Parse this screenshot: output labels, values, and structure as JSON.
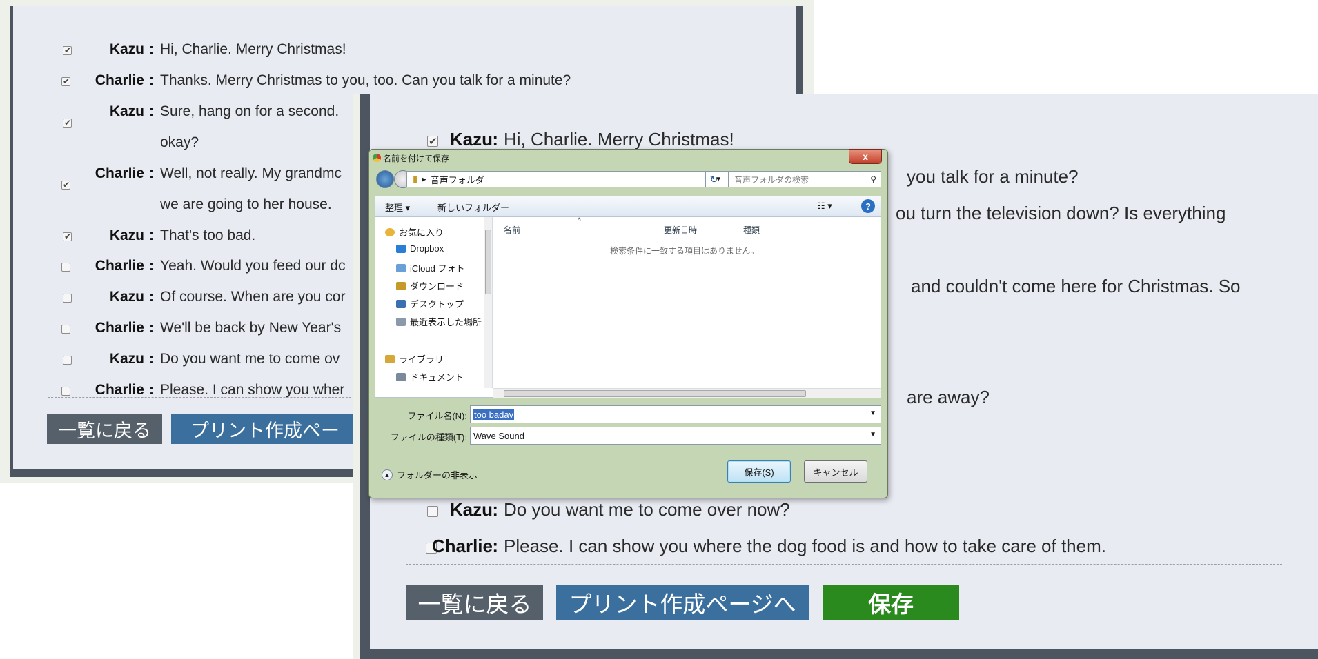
{
  "dialogue": [
    {
      "speaker": "Kazu",
      "text": "Hi, Charlie. Merry Christmas!",
      "checked": true
    },
    {
      "speaker": "Charlie",
      "text": "Thanks. Merry Christmas to you, too. Can you talk for a minute?",
      "checked": true
    },
    {
      "speaker": "Kazu",
      "text": "Sure, hang on for a second.",
      "text_line2": "okay?",
      "checked": true
    },
    {
      "speaker": "Charlie",
      "text": "Well, not really. My grandmc",
      "text_line2": "we are going to her house.",
      "checked": true
    },
    {
      "speaker": "Kazu",
      "text": "That's too bad.",
      "checked": true
    },
    {
      "speaker": "Charlie",
      "text": "Yeah. Would you feed our dc",
      "checked": false
    },
    {
      "speaker": "Kazu",
      "text": "Of course. When are you cor",
      "checked": false
    },
    {
      "speaker": "Charlie",
      "text": "We'll be back by New Year's",
      "checked": false
    },
    {
      "speaker": "Kazu",
      "text": "Do you want me to come ov",
      "checked": false
    },
    {
      "speaker": "Charlie",
      "text": "Please. I can show you wher",
      "checked": false
    }
  ],
  "speaker_sep": " :",
  "back_buttons": {
    "back": "一覧に戻る",
    "print": "プリント作成ペー"
  },
  "front": {
    "rows": [
      {
        "speaker": "Kazu",
        "text": "Hi, Charlie. Merry Christmas!",
        "checked": true
      },
      {
        "text": "you talk for a minute?"
      },
      {
        "text": "ou turn the television down? Is everything"
      },
      {
        "text": "and couldn't come here for Christmas. So"
      },
      {
        "text": "are away?"
      },
      {
        "speaker": "Kazu",
        "text": "Do you want me to come over now?",
        "checked": false
      },
      {
        "speaker": "Charlie",
        "text": "Please. I can show you where the dog food is and how to take care of them.",
        "checked": false
      }
    ],
    "buttons": {
      "back": "一覧に戻る",
      "print": "プリント作成ページへ",
      "save": "保存"
    },
    "colors": {
      "back_button": "#56606b",
      "print_button": "#3b6f9e",
      "save_button": "#2b8a1e",
      "frame": "#4d5560"
    }
  },
  "dialog": {
    "title": "名前を付けて保存",
    "close_label": "x",
    "address": "音声フォルダ",
    "search_placeholder": "音声フォルダの検索",
    "toolbar": {
      "organize": "整理 ▾",
      "new_folder": "新しいフォルダー",
      "view": "☷ ▾",
      "help": "?"
    },
    "nav_items": [
      {
        "label": "お気に入り",
        "icon": "star-icon"
      },
      {
        "label": "Dropbox",
        "icon": "dropbox-icon"
      },
      {
        "label": "iCloud フォト",
        "icon": "icloud-icon"
      },
      {
        "label": "ダウンロード",
        "icon": "download-folder-icon"
      },
      {
        "label": "デスクトップ",
        "icon": "desktop-icon"
      },
      {
        "label": "最近表示した場所",
        "icon": "recent-places-icon"
      },
      {
        "label": "ライブラリ",
        "icon": "library-icon"
      },
      {
        "label": "ドキュメント",
        "icon": "documents-icon"
      }
    ],
    "columns": {
      "name": "名前",
      "modified": "更新日時",
      "type": "種類"
    },
    "empty_message": "検索条件に一致する項目はありません。",
    "filename_label": "ファイル名(N):",
    "filename_value": "too badav",
    "filetype_label": "ファイルの種類(T):",
    "filetype_value": "Wave Sound",
    "save_button": "保存(S)",
    "cancel_button": "キャンセル",
    "hide_folders": "フォルダーの非表示"
  }
}
